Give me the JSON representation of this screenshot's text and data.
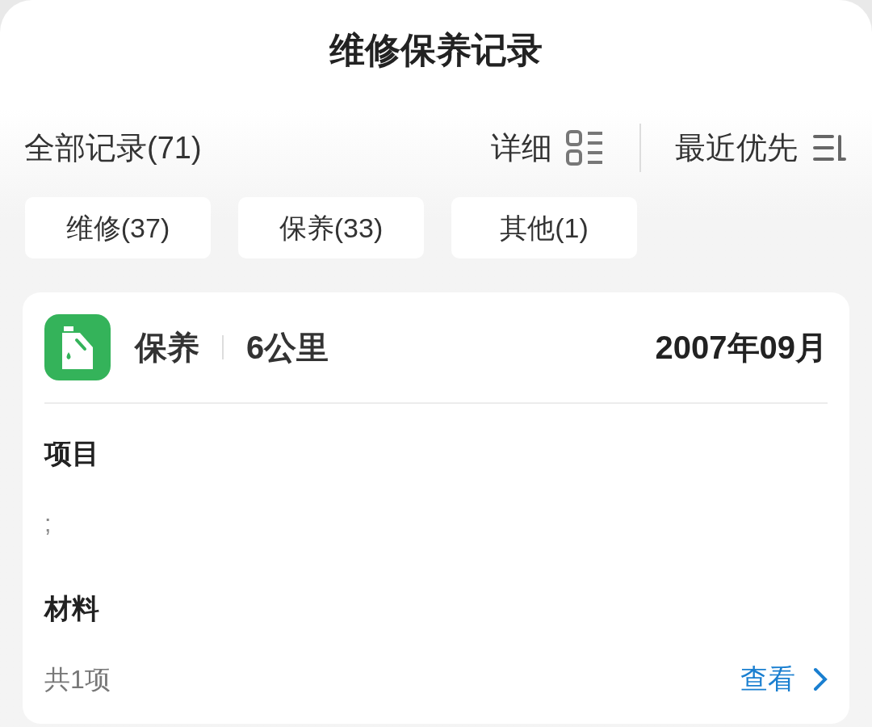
{
  "title": "维修保养记录",
  "toolbar": {
    "all_records": "全部记录(71)",
    "view_mode": "详细",
    "sort": "最近优先"
  },
  "filters": [
    {
      "label": "维修(37)",
      "selected": false
    },
    {
      "label": "保养(33)",
      "selected": false
    },
    {
      "label": "其他(1)",
      "selected": false
    }
  ],
  "records": [
    {
      "kind": "maintenance",
      "type": "保养",
      "mileage": "6公里",
      "date": "2007年09月",
      "items_label": "项目",
      "items": ";",
      "materials_label": "材料",
      "materials_count": "共1项",
      "view_link": "查看"
    }
  ]
}
